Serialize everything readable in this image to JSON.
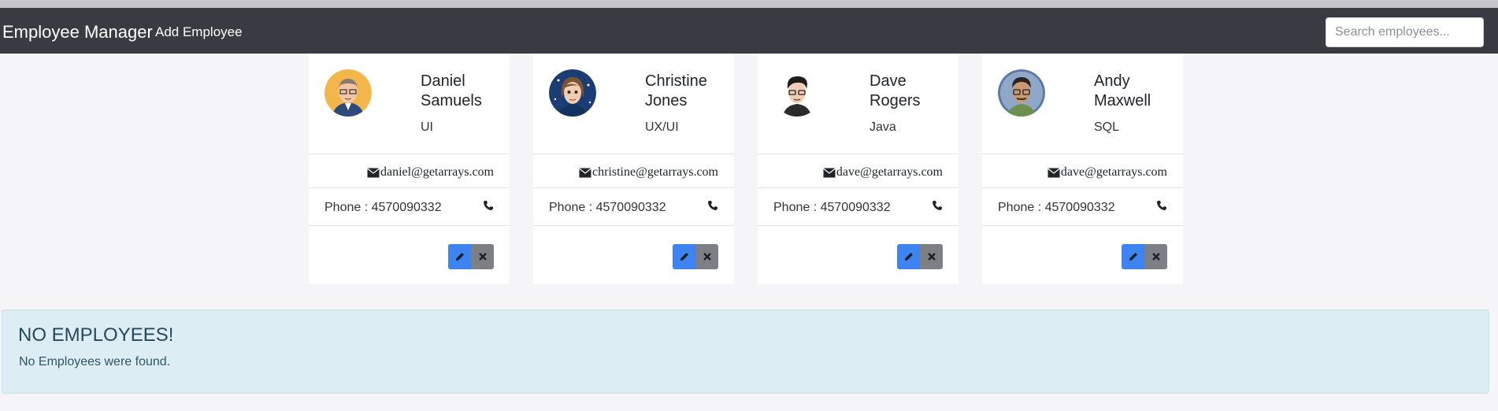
{
  "navbar": {
    "brand": "Employee Manager",
    "add_link": "Add Employee",
    "search_placeholder": "Search employees..."
  },
  "employees": [
    {
      "name": "Daniel Samuels",
      "job": "UI",
      "email": "daniel@getarrays.com",
      "phone": "Phone : 4570090332",
      "avatar_bg": "#f2b64b"
    },
    {
      "name": "Christine Jones",
      "job": "UX/UI",
      "email": "christine@getarrays.com",
      "phone": "Phone : 4570090332",
      "avatar_bg": "#1c3d73"
    },
    {
      "name": "Dave Rogers",
      "job": "Java",
      "email": "dave@getarrays.com",
      "phone": "Phone : 4570090332",
      "avatar_bg": "#ffffff"
    },
    {
      "name": "Andy Maxwell",
      "job": "SQL",
      "email": "dave@getarrays.com",
      "phone": "Phone : 4570090332",
      "avatar_bg": "#5b7aa6"
    }
  ],
  "icons": {
    "email": "envelope-icon",
    "phone": "phone-icon",
    "edit": "pencil-icon",
    "delete": "close-icon"
  },
  "alert": {
    "heading": "NO EMPLOYEES!",
    "text": "No Employees were found."
  },
  "colors": {
    "navbar": "#383b42",
    "edit_button": "#3d83f2",
    "delete_button": "#7c7f85",
    "alert_bg": "#dcedf3"
  }
}
